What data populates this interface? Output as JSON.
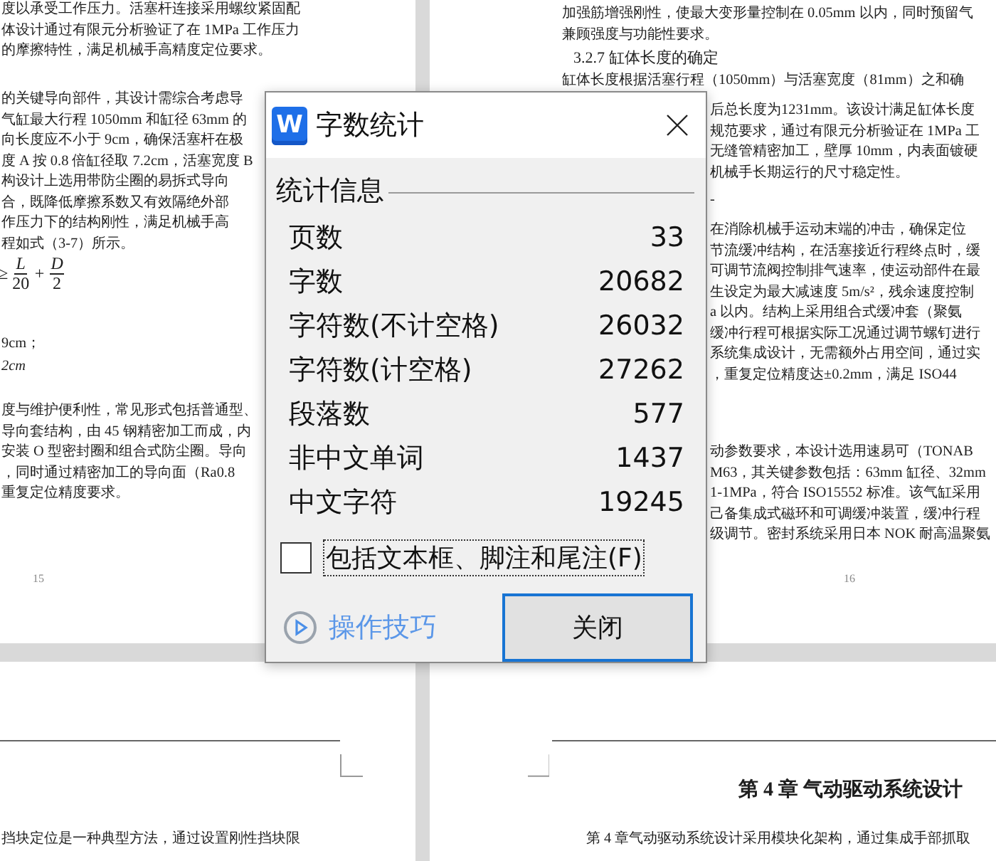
{
  "document": {
    "pages": [
      {
        "page_number": "15",
        "blocks": [
          {
            "kind": "paragraph",
            "lines": [
              "度以承受工作压力。活塞杆连接采用螺纹紧固配",
              "体设计通过有限元分析验证了在 1MPa 工作压力",
              "的摩擦特性，满足机械手高精度定位要求。"
            ]
          },
          {
            "kind": "paragraph",
            "lines": [
              "的关键导向部件，其设计需综合考虑导",
              "气缸最大行程 1050mm 和缸径 63mm 的",
              "向长度应不小于 9cm，确保活塞杆在极",
              "度 A 按 0.8 倍缸径取 7.2cm，活塞宽度 B",
              "构设计上选用带防尘圈的易拆式导向",
              "合，既降低摩擦系数又有效隔绝外部",
              "作压力下的结构刚性，满足机械手高",
              "程如式（3-7）所示。"
            ]
          },
          {
            "kind": "formula",
            "relation": "≥",
            "operator": "+",
            "fractions": [
              {
                "numerator": "L",
                "denominator": "20"
              },
              {
                "numerator": "D",
                "denominator": "2"
              }
            ]
          },
          {
            "kind": "paragraph",
            "lines": [
              "9cm；"
            ]
          },
          {
            "kind": "math",
            "lines": [
              "2cm"
            ]
          },
          {
            "kind": "paragraph",
            "lines": [
              "度与维护便利性，常见形式包括普通型、",
              "导向套结构，由 45 钢精密加工而成，内",
              "安装 O 型密封圈和组合式防尘圈。导向",
              "，同时通过精密加工的导向面（Ra0.8",
              "重复定位精度要求。"
            ]
          }
        ]
      },
      {
        "page_number": "16",
        "blocks": [
          {
            "kind": "paragraph",
            "lines": [
              "加强筋增强刚性，使最大变形量控制在 0.05mm 以内，同时预留气",
              "兼顾强度与功能性要求。"
            ]
          },
          {
            "kind": "heading",
            "lines": [
              "3.2.7 缸体长度的确定"
            ]
          },
          {
            "kind": "paragraph",
            "lines": [
              "缸体长度根据活塞行程（1050mm）与活塞宽度（81mm）之和确"
            ]
          },
          {
            "kind": "continued",
            "lines": [
              "后总长度为1231mm。该设计满足缸体长度",
              "规范要求，通过有限元分析验证在 1MPa 工",
              "无缝管精密加工，壁厚 10mm，内表面镀硬",
              "机械手长期运行的尺寸稳定性。"
            ]
          },
          {
            "kind": "continued",
            "lines": [
              "-"
            ]
          },
          {
            "kind": "continued",
            "lines": [
              "在消除机械手运动末端的冲击，确保定位",
              "节流缓冲结构，在活塞接近行程终点时，缓",
              "可调节流阀控制排气速率，使运动部件在最",
              "生设定为最大减速度 5m/s²，残余速度控制",
              "a 以内。结构上采用组合式缓冲套（聚氨",
              "缓冲行程可根据实际工况通过调节螺钉进行",
              "系统集成设计，无需额外占用空间，通过实",
              "，重复定位精度达±0.2mm，满足 ISO44"
            ]
          },
          {
            "kind": "continued",
            "lines": [
              "动参数要求，本设计选用速易可（TONAB",
              "M63，其关键参数包括：63mm 缸径、32mm",
              "1-1MPa，符合 ISO15552 标准。该气缸采用",
              "己备集成式磁环和可调缓冲装置，缓冲行程",
              "级调节。密封系统采用日本 NOK 耐高温聚氨"
            ]
          }
        ]
      }
    ],
    "lower_pages": [
      {
        "blocks": [
          {
            "kind": "paragraph",
            "lines": [
              "挡块定位是一种典型方法，通过设置刚性挡块限"
            ]
          }
        ]
      },
      {
        "blocks": [
          {
            "kind": "chapter_heading",
            "lines": [
              "第 4 章  气动驱动系统设计"
            ]
          },
          {
            "kind": "paragraph",
            "lines": [
              "第 4 章气动驱动系统设计采用模块化架构，通过集成手部抓取"
            ]
          }
        ]
      }
    ]
  },
  "dialog": {
    "logo_text": "W",
    "title": "字数统计",
    "section": "统计信息",
    "stats": [
      {
        "label": "页数",
        "value": "33"
      },
      {
        "label": "字数",
        "value": "20682"
      },
      {
        "label": "字符数(不计空格)",
        "value": "26032"
      },
      {
        "label": "字符数(计空格)",
        "value": "27262"
      },
      {
        "label": "段落数",
        "value": "577"
      },
      {
        "label": "非中文单词",
        "value": "1437"
      },
      {
        "label": "中文字符",
        "value": "19245"
      }
    ],
    "checkbox": {
      "label": "包括文本框、脚注和尾注(F)",
      "checked": false
    },
    "tips_link": "操作技巧",
    "close_button": "关闭"
  }
}
